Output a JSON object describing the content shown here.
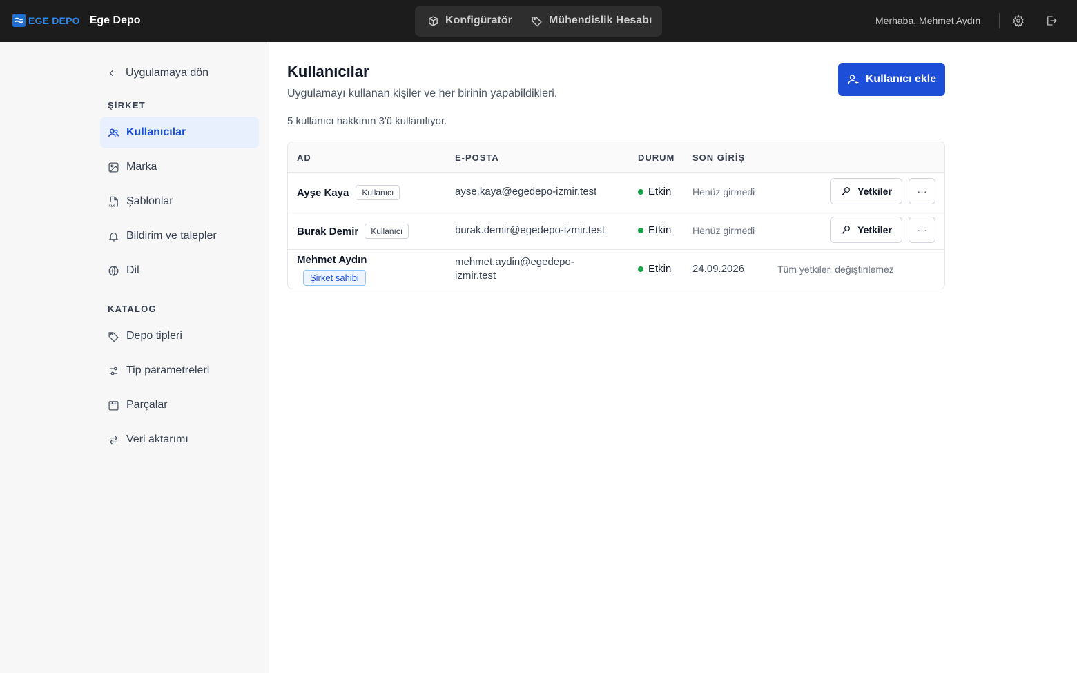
{
  "header": {
    "logo_text": "EGE DEPO",
    "app_name": "Ege Depo",
    "tabs": [
      {
        "label": "Konfigüratör",
        "icon": "cube-icon"
      },
      {
        "label": "Mühendislik Hesabı",
        "icon": "tag-icon"
      }
    ],
    "greeting": "Merhaba, Mehmet Aydın",
    "settings_icon": "gear-icon",
    "logout_icon": "logout-icon"
  },
  "sidebar": {
    "back_label": "Uygulamaya dön",
    "sections": [
      {
        "title": "ŞİRKET",
        "items": [
          {
            "label": "Kullanıcılar",
            "icon": "users-icon",
            "active": true
          },
          {
            "label": "Marka",
            "icon": "image-icon"
          },
          {
            "label": "Şablonlar",
            "icon": "xls-file-icon"
          },
          {
            "label": "Bildirim ve talepler",
            "icon": "bell-icon"
          },
          {
            "label": "Dil",
            "icon": "globe-icon"
          }
        ]
      },
      {
        "title": "KATALOG",
        "items": [
          {
            "label": "Depo tipleri",
            "icon": "tag-icon"
          },
          {
            "label": "Tip parametreleri",
            "icon": "sliders-icon"
          },
          {
            "label": "Parçalar",
            "icon": "package-icon"
          },
          {
            "label": "Veri aktarımı",
            "icon": "transfer-icon"
          }
        ]
      }
    ]
  },
  "main": {
    "title": "Kullanıcılar",
    "subtitle": "Uygulamayı kullanan kişiler ve her birinin yapabildikleri.",
    "quota": "5 kullanıcı hakkının 3'ü kullanılıyor.",
    "add_button": "Kullanıcı ekle",
    "accent": "#1d4ed8",
    "columns": [
      "AD",
      "E-POSTA",
      "DURUM",
      "SON GİRİŞ"
    ],
    "users": [
      {
        "name": "Ayşe Kaya",
        "role": "Kullanıcı",
        "email": "ayse.kaya@egedepo-izmir.test",
        "status": "Etkin",
        "last_login": "Henüz girmedi",
        "perm_button": "Yetkiler",
        "more": "···"
      },
      {
        "name": "Burak Demir",
        "role": "Kullanıcı",
        "email": "burak.demir@egedepo-izmir.test",
        "status": "Etkin",
        "last_login": "Henüz girmedi",
        "perm_button": "Yetkiler",
        "more": "···"
      },
      {
        "name": "Mehmet Aydın",
        "role": "Şirket sahibi",
        "email_line1": "mehmet.aydin@egedepo-",
        "email_line2": "izmir.test",
        "status": "Etkin",
        "last_login": "24.09.2026",
        "note": "Tüm yetkiler, değiştirilemez"
      }
    ],
    "status_color": "#16a34a"
  }
}
